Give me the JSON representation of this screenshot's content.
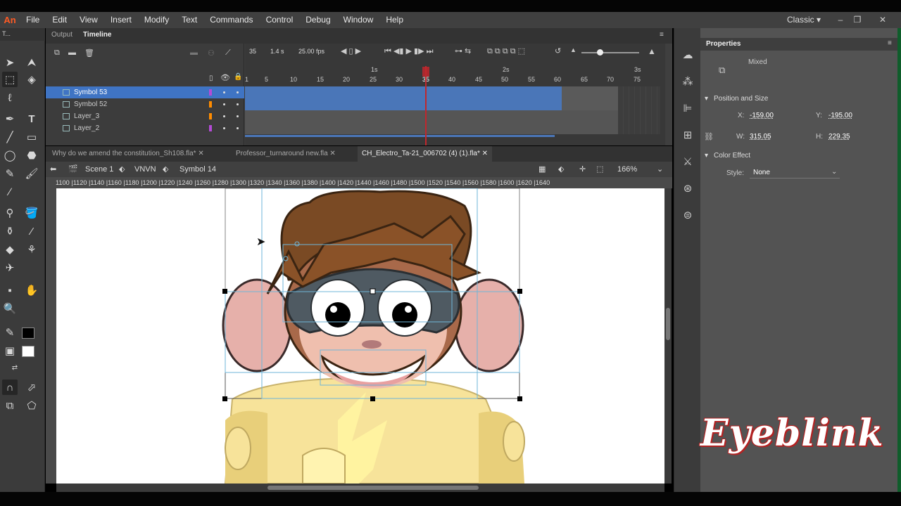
{
  "app": {
    "logo": "An",
    "menu": [
      "File",
      "Edit",
      "View",
      "Insert",
      "Modify",
      "Text",
      "Commands",
      "Control",
      "Debug",
      "Window",
      "Help"
    ],
    "workspace": "Classic ▾"
  },
  "tools_header": "T...",
  "timeline": {
    "tabs": [
      "Output",
      "Timeline"
    ],
    "current_frame": "35",
    "time": "1.4 s",
    "fps": "25.00 fps",
    "time_labels": [
      "1s",
      "2s",
      "3s"
    ],
    "frame_ticks": [
      "1",
      "5",
      "10",
      "15",
      "20",
      "25",
      "30",
      "35",
      "40",
      "45",
      "50",
      "55",
      "60",
      "65",
      "70",
      "75"
    ],
    "layers": [
      {
        "name": "Symbol 53",
        "color": "#b44bd6",
        "selected": true
      },
      {
        "name": "Symbol 52",
        "color": "#ff8c00",
        "selected": false
      },
      {
        "name": "Layer_3",
        "color": "#ff8c00",
        "selected": false
      },
      {
        "name": "Layer_2",
        "color": "#b44bd6",
        "selected": false
      }
    ]
  },
  "documents": {
    "tabs": [
      "Why do we amend the constitution_Sh108.fla*",
      "Professor_turnaround new.fla",
      "CH_Electro_Ta-21_006702 (4) (1).fla*"
    ],
    "active": 2
  },
  "breadcrumb": {
    "items": [
      "Scene 1",
      "VNVN",
      "Symbol 14"
    ],
    "zoom": "166%"
  },
  "ruler": {
    "top": "1100 |1120 |1140 |1160 |1180 |1200 |1220 |1240 |1260 |1280 |1300 |1320 |1340 |1360 |1380 |1400 |1420 |1440 |1460 |1480 |1500 |1520 |1540 |1560 |1580 |1600 |1620 |1640"
  },
  "properties": {
    "title": "Properties",
    "selection_label": "Mixed",
    "position_size_header": "Position and Size",
    "x_label": "X:",
    "x_value": "-159.00",
    "y_label": "Y:",
    "y_value": "-195.00",
    "w_label": "W:",
    "w_value": "315.05",
    "h_label": "H:",
    "h_value": "229.35",
    "color_effect_header": "Color Effect",
    "style_label": "Style:",
    "style_value": "None"
  },
  "watermark": "Eyeblink"
}
